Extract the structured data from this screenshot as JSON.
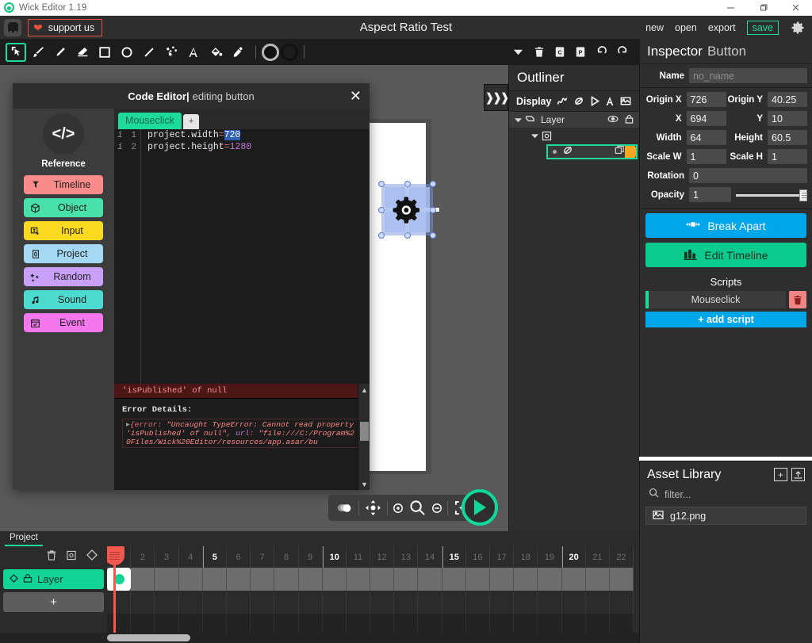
{
  "window": {
    "app_title": "Wick Editor 1.19",
    "controls": {
      "minimize": "minimize-icon",
      "maximize": "maximize-icon",
      "close": "close-icon"
    }
  },
  "menubar": {
    "support_label": "support us",
    "project_title": "Aspect Ratio Test",
    "items": [
      {
        "label": "new",
        "name": "new"
      },
      {
        "label": "open",
        "name": "open"
      },
      {
        "label": "export",
        "name": "export"
      },
      {
        "label": "save",
        "name": "save"
      }
    ],
    "settings_icon": "gear-icon"
  },
  "toolbar": {
    "tools": [
      {
        "name": "cursor",
        "selected": true
      },
      {
        "name": "brush",
        "selected": false
      },
      {
        "name": "pencil",
        "selected": false
      },
      {
        "name": "eraser",
        "selected": false
      },
      {
        "name": "rectangle",
        "selected": false
      },
      {
        "name": "ellipse",
        "selected": false
      },
      {
        "name": "line",
        "selected": false
      },
      {
        "name": "path",
        "selected": false
      },
      {
        "name": "text",
        "selected": false
      },
      {
        "name": "fill-bucket",
        "selected": false
      },
      {
        "name": "eyedropper",
        "selected": false
      }
    ],
    "fill_color": "#111111",
    "stroke_color": "#111111",
    "actions": [
      "chevron-down",
      "trash",
      "copy",
      "paste",
      "undo",
      "redo"
    ]
  },
  "code_editor": {
    "title": "Code Editor",
    "separator": "|",
    "subtitle": "editing button",
    "close_label": "✕",
    "reference": {
      "icon_text": "</>",
      "label": "Reference",
      "buttons": [
        {
          "label": "Timeline",
          "color": "#fa8b8b",
          "icon": "pin-icon"
        },
        {
          "label": "Object",
          "color": "#48e1ab",
          "icon": "cube-icon"
        },
        {
          "label": "Input",
          "color": "#fada20",
          "icon": "input-icon"
        },
        {
          "label": "Project",
          "color": "#a5d8f3",
          "icon": "document-icon"
        },
        {
          "label": "Random",
          "color": "#c9a0f7",
          "icon": "sparkle-icon"
        },
        {
          "label": "Sound",
          "color": "#4ddbd0",
          "icon": "music-icon"
        },
        {
          "label": "Event",
          "color": "#f577ee",
          "icon": "calendar-icon"
        }
      ]
    },
    "tabs": [
      {
        "label": "Mouseclick",
        "active": true
      },
      {
        "label": "+",
        "active": false
      }
    ],
    "lines": [
      {
        "num": "1",
        "prefix": "project.width",
        "op": "=",
        "value": "720",
        "selected": true
      },
      {
        "num": "2",
        "prefix": "project.height",
        "op": "=",
        "value": "1280",
        "selected": false
      }
    ],
    "console": {
      "header": "'isPublished' of null",
      "details_label": "Error Details:",
      "error_open": "{",
      "error_key1": "error",
      "error_val1": "\"Uncaught TypeError: Cannot read property 'isPublished' of null\"",
      "error_key2": "url",
      "error_val2": "\"file:///C:/Program%20Files/Wick%20Editor/resources/app.asar/bu"
    }
  },
  "canvas": {
    "collapse_icon": "chevron-right-triple",
    "object_icon": "gear-icon",
    "playback": [
      {
        "name": "onion-skin"
      },
      {
        "name": "pan"
      },
      {
        "name": "zoom-in"
      },
      {
        "name": "magnifier"
      },
      {
        "name": "zoom-out"
      },
      {
        "name": "fit-to-screen"
      }
    ],
    "play_button": "play-icon"
  },
  "outliner": {
    "title": "Outliner",
    "display_label": "Display",
    "display_icons": [
      "path-icon",
      "shape-icon",
      "play-icon",
      "text-icon",
      "image-icon"
    ],
    "tree": [
      {
        "label": "Layer",
        "level": 1,
        "icon": "layer-icon",
        "eye": "eye-icon",
        "lock": "lock-icon"
      },
      {
        "label": "",
        "level": 2,
        "icon": "clip-icon"
      },
      {
        "label": "",
        "level": 3,
        "icon": "shape-icon",
        "selected": true
      }
    ]
  },
  "inspector": {
    "title": "Inspector",
    "subject": "Button",
    "name_label": "Name",
    "name_placeholder": "no_name",
    "name_value": "",
    "fields": [
      {
        "label": "Origin X",
        "value": "726"
      },
      {
        "label": "Origin Y",
        "value": "40.25"
      },
      {
        "label": "X",
        "value": "694"
      },
      {
        "label": "Y",
        "value": "10"
      },
      {
        "label": "Width",
        "value": "64"
      },
      {
        "label": "Height",
        "value": "60.5"
      },
      {
        "label": "Scale W",
        "value": "1"
      },
      {
        "label": "Scale H",
        "value": "1"
      },
      {
        "label": "Rotation",
        "value": "0"
      },
      {
        "label": "Opacity",
        "value": "1"
      }
    ],
    "break_apart": "Break Apart",
    "edit_timeline": "Edit Timeline",
    "scripts_header": "Scripts",
    "scripts": [
      {
        "label": "Mouseclick"
      }
    ],
    "add_script": "+ add script",
    "accent_blue": "#00a7eb",
    "accent_green": "#0bcb8e"
  },
  "assets": {
    "title": "Asset Library",
    "add_label": "+",
    "upload_label": "↑",
    "filter_placeholder": "filter...",
    "items": [
      {
        "label": "g12.png",
        "icon": "image-icon"
      }
    ]
  },
  "timeline": {
    "tab": "Project",
    "tools": [
      "trash-icon",
      "copy-frame-icon",
      "diamond-icon"
    ],
    "layers": [
      {
        "label": "Layer",
        "eye": "diamond-icon",
        "lock": "lock-icon"
      }
    ],
    "add_layer": "+",
    "frames": [
      "1",
      "2",
      "3",
      "4",
      "5",
      "6",
      "7",
      "8",
      "9",
      "10",
      "11",
      "12",
      "13",
      "14",
      "15",
      "16",
      "17",
      "18",
      "19",
      "20",
      "21",
      "22"
    ],
    "major_frames": [
      "5",
      "10",
      "15",
      "20"
    ],
    "playhead_frame": "1",
    "keyframe_frame": "1"
  }
}
